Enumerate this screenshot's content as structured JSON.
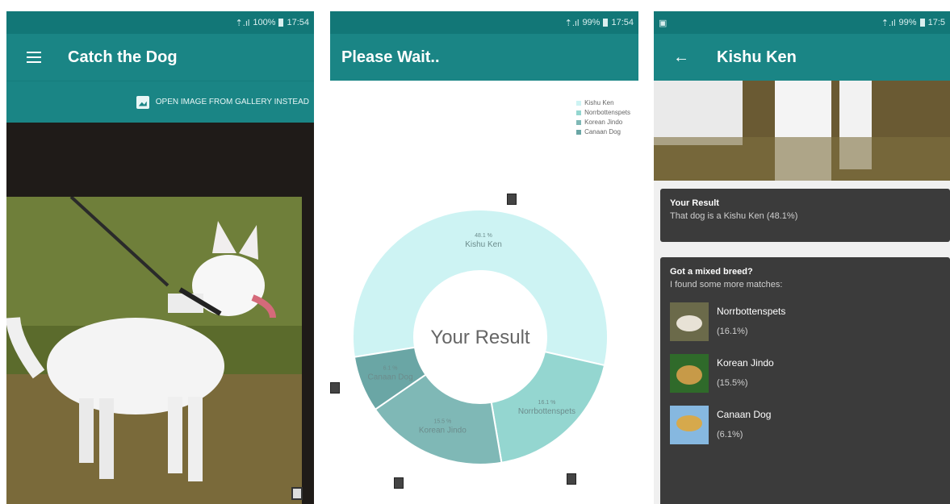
{
  "screen1": {
    "status": {
      "signal": "⇡.ıl",
      "battery": "100%",
      "time": "17:54"
    },
    "title": "Catch the Dog",
    "gallery_label": "OPEN IMAGE FROM GALLERY INSTEAD"
  },
  "screen2": {
    "status": {
      "signal": "⇡.ıl",
      "battery": "99%",
      "time": "17:54"
    },
    "title": "Please Wait..",
    "legend": [
      {
        "label": "Kishu Ken",
        "color": "#cdf3f3"
      },
      {
        "label": "Norrbottenspets",
        "color": "#94d6d0"
      },
      {
        "label": "Korean Jindo",
        "color": "#7fb8b6"
      },
      {
        "label": "Canaan Dog",
        "color": "#6aa6a5"
      }
    ],
    "center_text": "Your Result"
  },
  "chart_data": {
    "type": "pie",
    "center_label": "Your Result",
    "slices": [
      {
        "name": "Kishu Ken",
        "value": 48.1,
        "label_value": "48.1 %",
        "color": "#cdf3f3"
      },
      {
        "name": "Norrbottenspets",
        "value": 16.1,
        "label_value": "16.1 %",
        "color": "#94d6d0"
      },
      {
        "name": "Korean Jindo",
        "value": 15.5,
        "label_value": "15.5 %",
        "color": "#7fb8b6"
      },
      {
        "name": "Canaan Dog",
        "value": 6.1,
        "label_value": "6.1 %",
        "color": "#6aa6a5"
      }
    ]
  },
  "screen3": {
    "status": {
      "signal": "⇡.ıl",
      "battery": "99%",
      "time": "17:5"
    },
    "title": "Kishu Ken",
    "result_card": {
      "title": "Your Result",
      "text": "That dog is a Kishu Ken (48.1%)"
    },
    "mixed_card": {
      "title": "Got a mixed breed?",
      "subtitle": "I found some more matches:",
      "matches": [
        {
          "name": "Norrbottenspets",
          "pct": "(16.1%)"
        },
        {
          "name": "Korean Jindo",
          "pct": "(15.5%)"
        },
        {
          "name": "Canaan Dog",
          "pct": "(6.1%)"
        }
      ]
    }
  }
}
